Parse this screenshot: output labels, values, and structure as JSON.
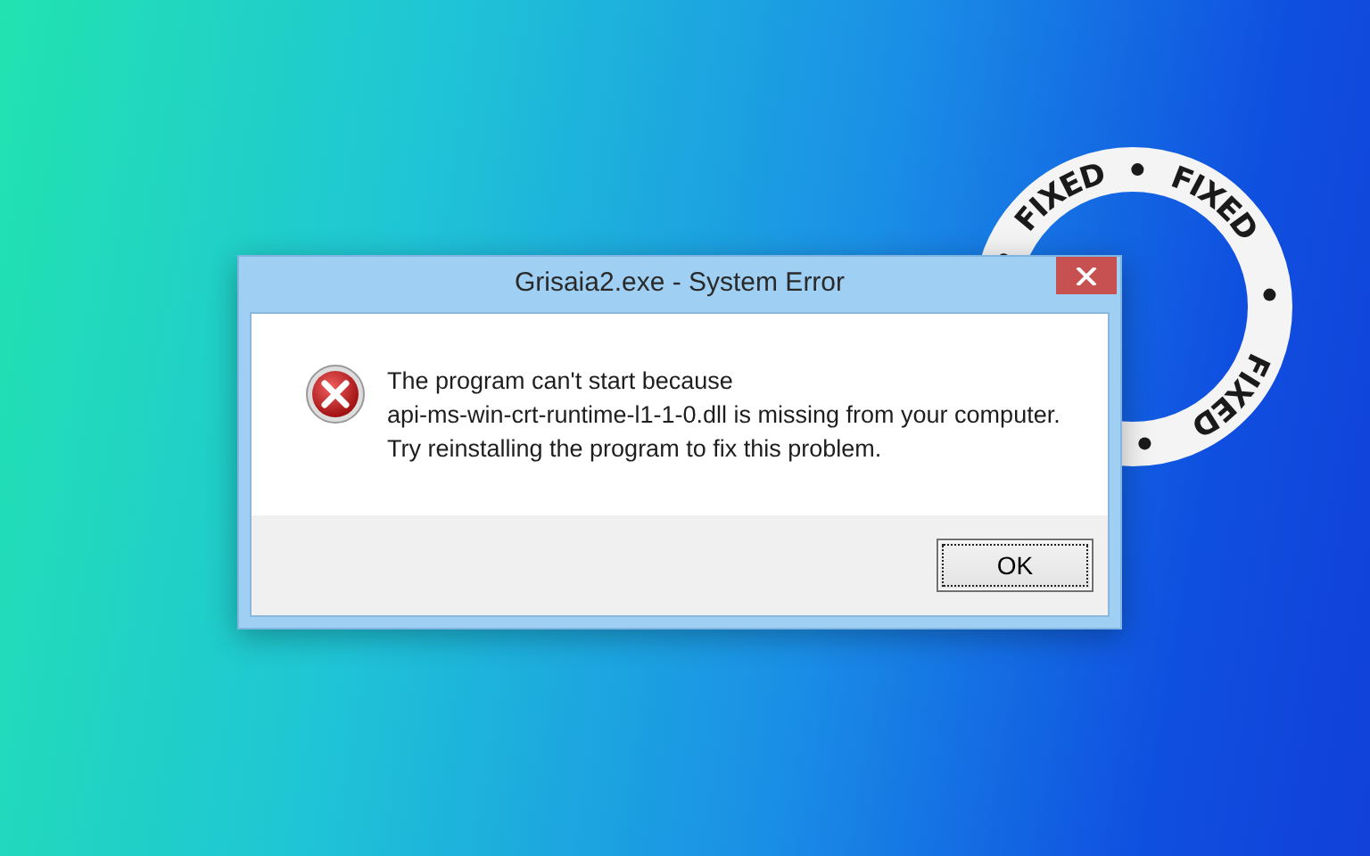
{
  "badge": {
    "labels": [
      "FIXED",
      "FIXED",
      "FIXED"
    ]
  },
  "dialog": {
    "title": "Grisaia2.exe - System Error",
    "message_lines": [
      "The program can't start because",
      "api-ms-win-crt-runtime-l1-1-0.dll is missing from your computer.",
      "Try reinstalling the program to fix this problem."
    ],
    "buttons": [
      {
        "label": "OK",
        "focused": true
      }
    ]
  }
}
